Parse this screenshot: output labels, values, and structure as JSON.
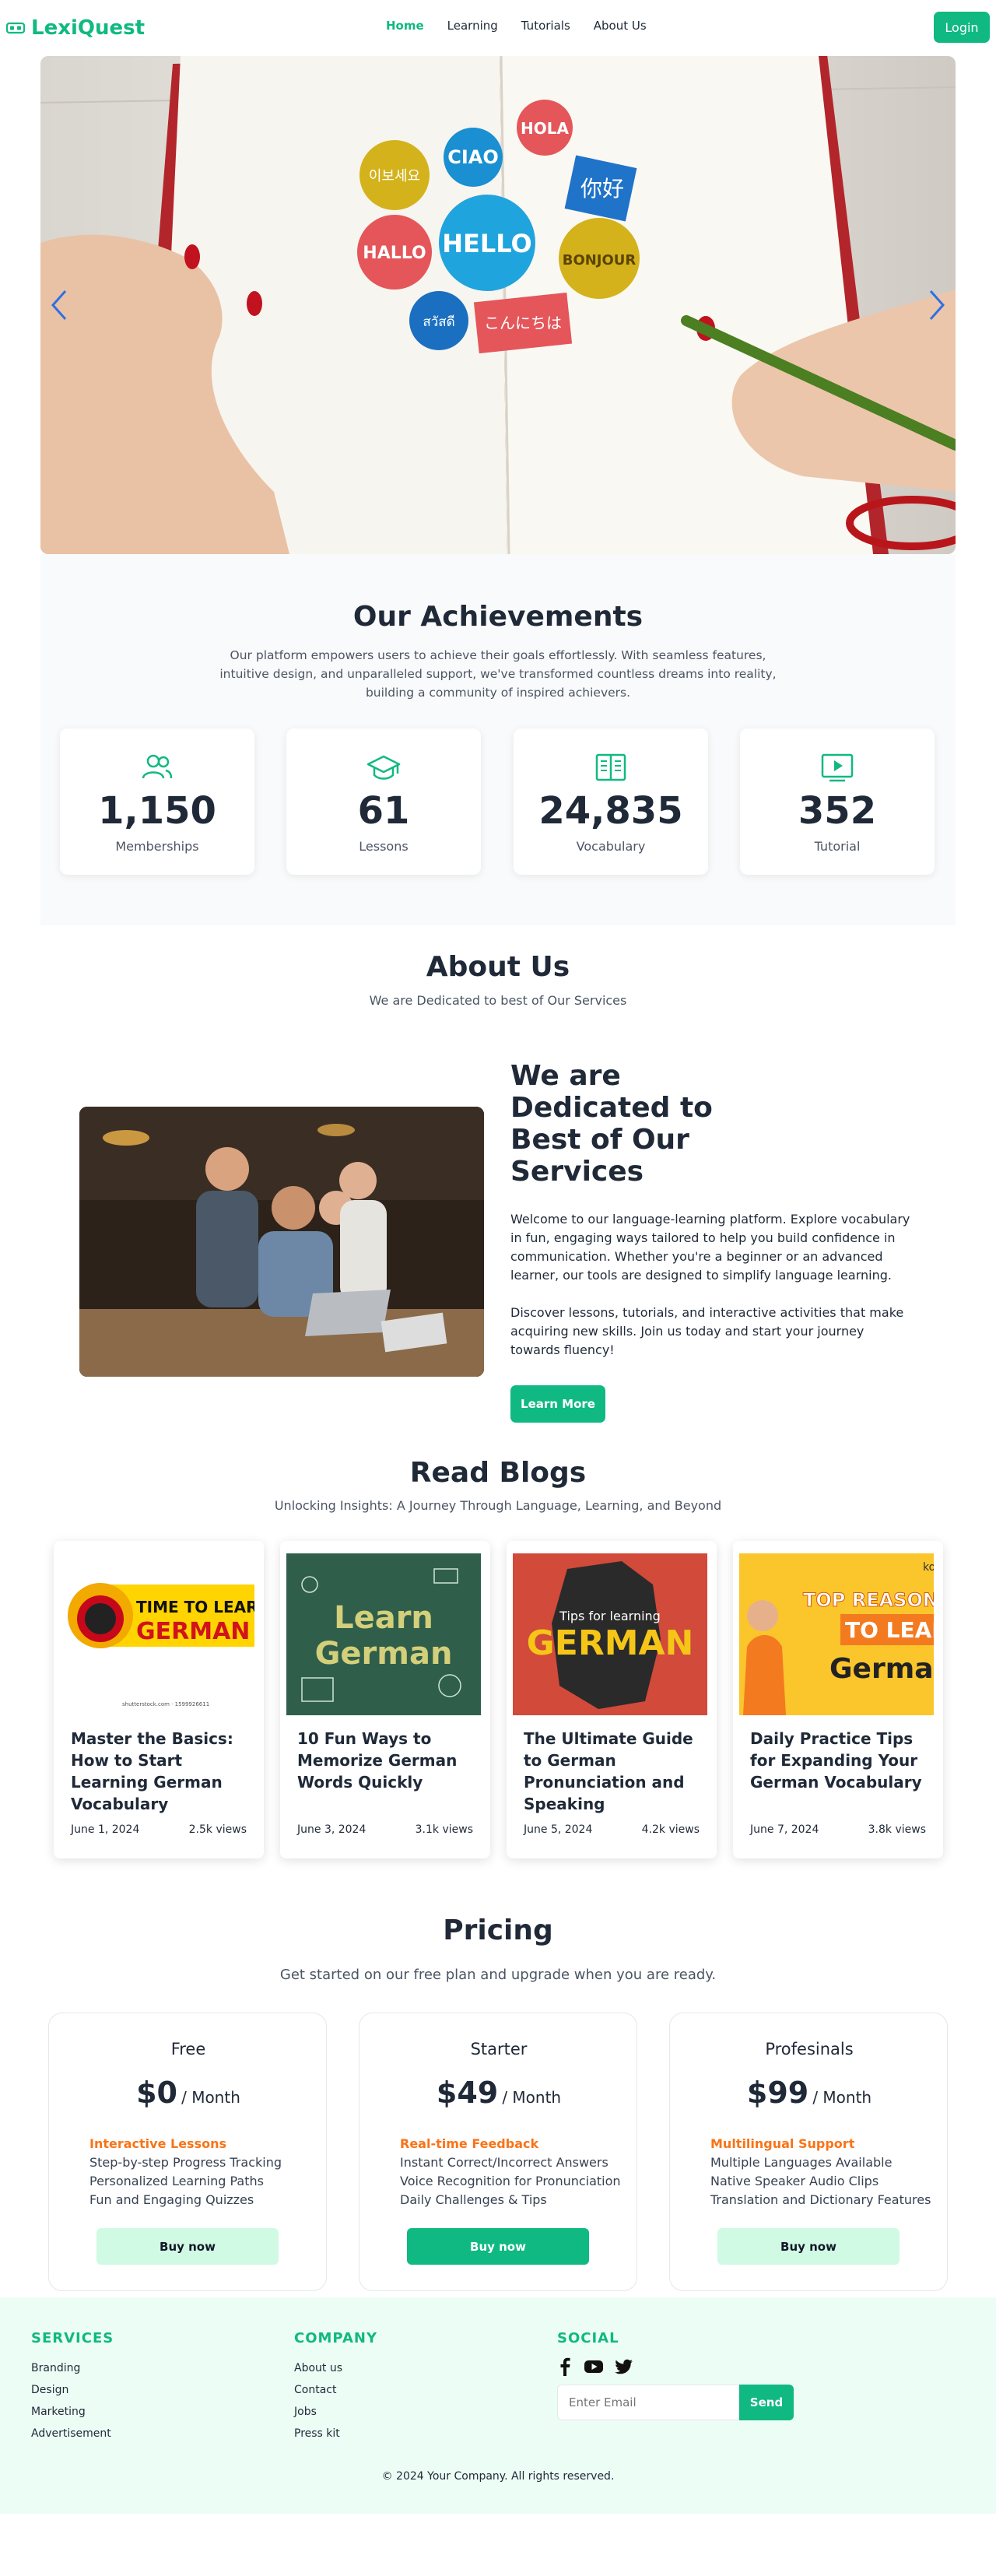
{
  "nav": {
    "brand": "LexiQuest",
    "links": [
      "Home",
      "Learning",
      "Tutorials",
      "About Us"
    ],
    "login": "Login"
  },
  "hero": {
    "bubbles": [
      "이보세요",
      "CIAO",
      "HOLA",
      "你好",
      "HALLO",
      "HELLO",
      "BONJOUR",
      "สวัสดี",
      "こんにちは"
    ]
  },
  "achievements": {
    "title": "Our Achievements",
    "description": "Our platform empowers users to achieve their goals effortlessly. With seamless features, intuitive design, and unparalleled support, we've transformed countless dreams into reality, building a community of inspired achievers.",
    "stats": [
      {
        "value": "1,150",
        "label": "Memberships",
        "icon": "users-icon"
      },
      {
        "value": "61",
        "label": "Lessons",
        "icon": "graduation-cap-icon"
      },
      {
        "value": "24,835",
        "label": "Vocabulary",
        "icon": "book-open-icon"
      },
      {
        "value": "352",
        "label": "Tutorial",
        "icon": "play-screen-icon"
      }
    ]
  },
  "about": {
    "title": "About Us",
    "subtitle": "We are Dedicated to best of Our Services",
    "heading": "We are Dedicated to Best of Our Services",
    "p1": "Welcome to our language-learning platform. Explore vocabulary in fun, engaging ways tailored to help you build confidence in communication. Whether you're a beginner or an advanced learner, our tools are designed to simplify language learning.",
    "p2": "Discover lessons, tutorials, and interactive activities that make acquiring new skills. Join us today and start your journey towards fluency!",
    "button": "Learn More"
  },
  "blogs": {
    "title": "Read Blogs",
    "subtitle": "Unlocking Insights: A Journey Through Language, Learning, and Beyond",
    "items": [
      {
        "title": "Master the Basics: How to Start Learning German Vocabulary",
        "date": "June 1, 2024",
        "views": "2.5k views",
        "thumb_text": "TIME TO LEARN",
        "thumb_text2": "GERMAN",
        "thumb_credit": "shutterstock.com · 1599926611"
      },
      {
        "title": "10 Fun Ways to Memorize German Words Quickly",
        "date": "June 3, 2024",
        "views": "3.1k views",
        "thumb_text": "Learn",
        "thumb_text2": "German"
      },
      {
        "title": "The Ultimate Guide to German Pronunciation and Speaking",
        "date": "June 5, 2024",
        "views": "4.2k views",
        "thumb_text": "Tips for learning",
        "thumb_text2": "GERMAN"
      },
      {
        "title": "Daily Practice Tips for Expanding Your German Vocabulary",
        "date": "June 7, 2024",
        "views": "3.8k views",
        "thumb_text": "TOP REASON",
        "thumb_text2": "TO LEARN",
        "thumb_text3": "German",
        "thumb_corner": "ko"
      }
    ]
  },
  "pricing": {
    "title": "Pricing",
    "subtitle": "Get started on our free plan and upgrade when you are ready.",
    "per": "/ Month",
    "plans": [
      {
        "name": "Free",
        "price": "$0",
        "highlight": "Interactive Lessons",
        "features": [
          "Step-by-step Progress Tracking",
          "Personalized Learning Paths",
          "Fun and Engaging Quizzes"
        ],
        "button": "Buy now"
      },
      {
        "name": "Starter",
        "price": "$49",
        "highlight": "Real-time Feedback",
        "features": [
          "Instant Correct/Incorrect Answers",
          "Voice Recognition for Pronunciation",
          "Daily Challenges & Tips"
        ],
        "button": "Buy now"
      },
      {
        "name": "Profesinals",
        "price": "$99",
        "highlight": "Multilingual Support",
        "features": [
          "Multiple Languages Available",
          "Native Speaker Audio Clips",
          "Translation and Dictionary Features"
        ],
        "button": "Buy now"
      }
    ]
  },
  "footer": {
    "services_title": "SERVICES",
    "services": [
      "Branding",
      "Design",
      "Marketing",
      "Advertisement"
    ],
    "company_title": "COMPANY",
    "company": [
      "About us",
      "Contact",
      "Jobs",
      "Press kit"
    ],
    "social_title": "SOCIAL",
    "social_icons": [
      "facebook-icon",
      "youtube-icon",
      "twitter-icon"
    ],
    "email_placeholder": "Enter Email",
    "send": "Send",
    "copyright": "© 2024 Your Company. All rights reserved."
  },
  "colors": {
    "accent": "#10b981",
    "highlight": "#f97316",
    "text": "#1f2937"
  }
}
